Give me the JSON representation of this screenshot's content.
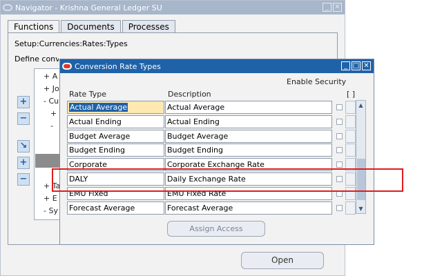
{
  "navigator": {
    "title": "Navigator - Krishna General Ledger SU",
    "tabs": [
      "Functions",
      "Documents",
      "Processes"
    ],
    "path": "Setup:Currencies:Rates:Types",
    "description": "Define conversion rate types",
    "tree": [
      "+ A",
      "+ Jo",
      "- Cu",
      "+",
      "-",
      "+ Ta",
      "+ E",
      "- Sy"
    ],
    "side_buttons": [
      "+",
      "−",
      "↘",
      "+",
      "−"
    ],
    "open_button": "Open"
  },
  "dialog": {
    "title": "Conversion Rate Types",
    "enable_security": "Enable Security",
    "bracket_label": "[ ]",
    "columns": {
      "rate_type": "Rate Type",
      "description": "Description"
    },
    "rows": [
      {
        "rate_type": "Actual Average",
        "description": "Actual Average",
        "selected": true
      },
      {
        "rate_type": "Actual Ending",
        "description": "Actual Ending"
      },
      {
        "rate_type": "Budget Average",
        "description": "Budget Average"
      },
      {
        "rate_type": "Budget Ending",
        "description": "Budget Ending"
      },
      {
        "rate_type": "Corporate",
        "description": "Corporate Exchange Rate"
      },
      {
        "rate_type": "DALY",
        "description": "Daily Exchange Rate",
        "highlighted": true
      },
      {
        "rate_type": "EMU Fixed",
        "description": "EMU Fixed Rate"
      },
      {
        "rate_type": "Forecast Average",
        "description": "Forecast Average"
      }
    ],
    "assign_button": "Assign Access"
  },
  "colors": {
    "dialog_title_bg": "#1f62a8",
    "nav_title_bg": "#a7b6ca",
    "highlight_box": "#e01b1b",
    "selected_cell": "#ffe9b0"
  }
}
